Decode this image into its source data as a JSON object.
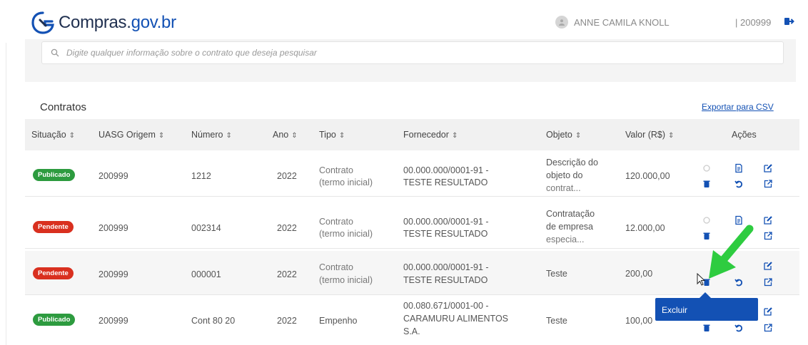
{
  "header": {
    "logo_text_main": "Compras.",
    "logo_text_domain": "gov.br",
    "user_name": "ANNE CAMILA KNOLL",
    "uasg": "| 200999"
  },
  "search": {
    "placeholder": "Digite qualquer informação sobre o contrato que deseja pesquisar"
  },
  "section": {
    "title": "Contratos",
    "export_label": "Exportar para CSV"
  },
  "table": {
    "columns": [
      "Situação",
      "UASG Origem",
      "Número",
      "Ano",
      "Tipo",
      "Fornecedor",
      "Objeto",
      "Valor (R$)",
      "Ações"
    ],
    "sort_glyph": "⇕",
    "rows": [
      {
        "status": "Publicado",
        "status_color": "#2d9b3f",
        "uasg": "200999",
        "numero": "1212",
        "ano": "2022",
        "tipo_1": "Contrato",
        "tipo_2": "(termo inicial)",
        "fornecedor_1": "00.000.000/0001-91 -",
        "fornecedor_2": "TESTE RESULTADO",
        "fornecedor_3": "",
        "objeto_1": "Descrição do",
        "objeto_2": "objeto do",
        "objeto_3": "contrat...",
        "valor": "120.000,00"
      },
      {
        "status": "Pendente",
        "status_color": "#d9301f",
        "uasg": "200999",
        "numero": "002314",
        "ano": "2022",
        "tipo_1": "Contrato",
        "tipo_2": "(termo inicial)",
        "fornecedor_1": "00.000.000/0001-91 -",
        "fornecedor_2": "TESTE RESULTADO",
        "fornecedor_3": "",
        "objeto_1": "Contratação",
        "objeto_2": "de empresa",
        "objeto_3": "especia...",
        "valor": "12.000,00"
      },
      {
        "status": "Pendente",
        "status_color": "#d9301f",
        "uasg": "200999",
        "numero": "000001",
        "ano": "2022",
        "tipo_1": "Contrato",
        "tipo_2": "(termo inicial)",
        "fornecedor_1": "00.000.000/0001-91 -",
        "fornecedor_2": "TESTE RESULTADO",
        "fornecedor_3": "",
        "objeto_1": "Teste",
        "objeto_2": "",
        "objeto_3": "",
        "valor": "200,00"
      },
      {
        "status": "Publicado",
        "status_color": "#2d9b3f",
        "uasg": "200999",
        "numero": "Cont 80 20",
        "ano": "2022",
        "tipo_1": "Empenho",
        "tipo_2": "",
        "fornecedor_1": "00.080.671/0001-00 -",
        "fornecedor_2": "CARAMURU ALIMENTOS",
        "fornecedor_3": "S.A.",
        "objeto_1": "Teste",
        "objeto_2": "",
        "objeto_3": "",
        "valor": "100,00"
      }
    ]
  },
  "tooltip": {
    "label": "Excluir"
  },
  "colors": {
    "brand": "#1351b4",
    "published": "#2d9b3f",
    "pending": "#d9301f",
    "arrow": "#2ecc40"
  }
}
